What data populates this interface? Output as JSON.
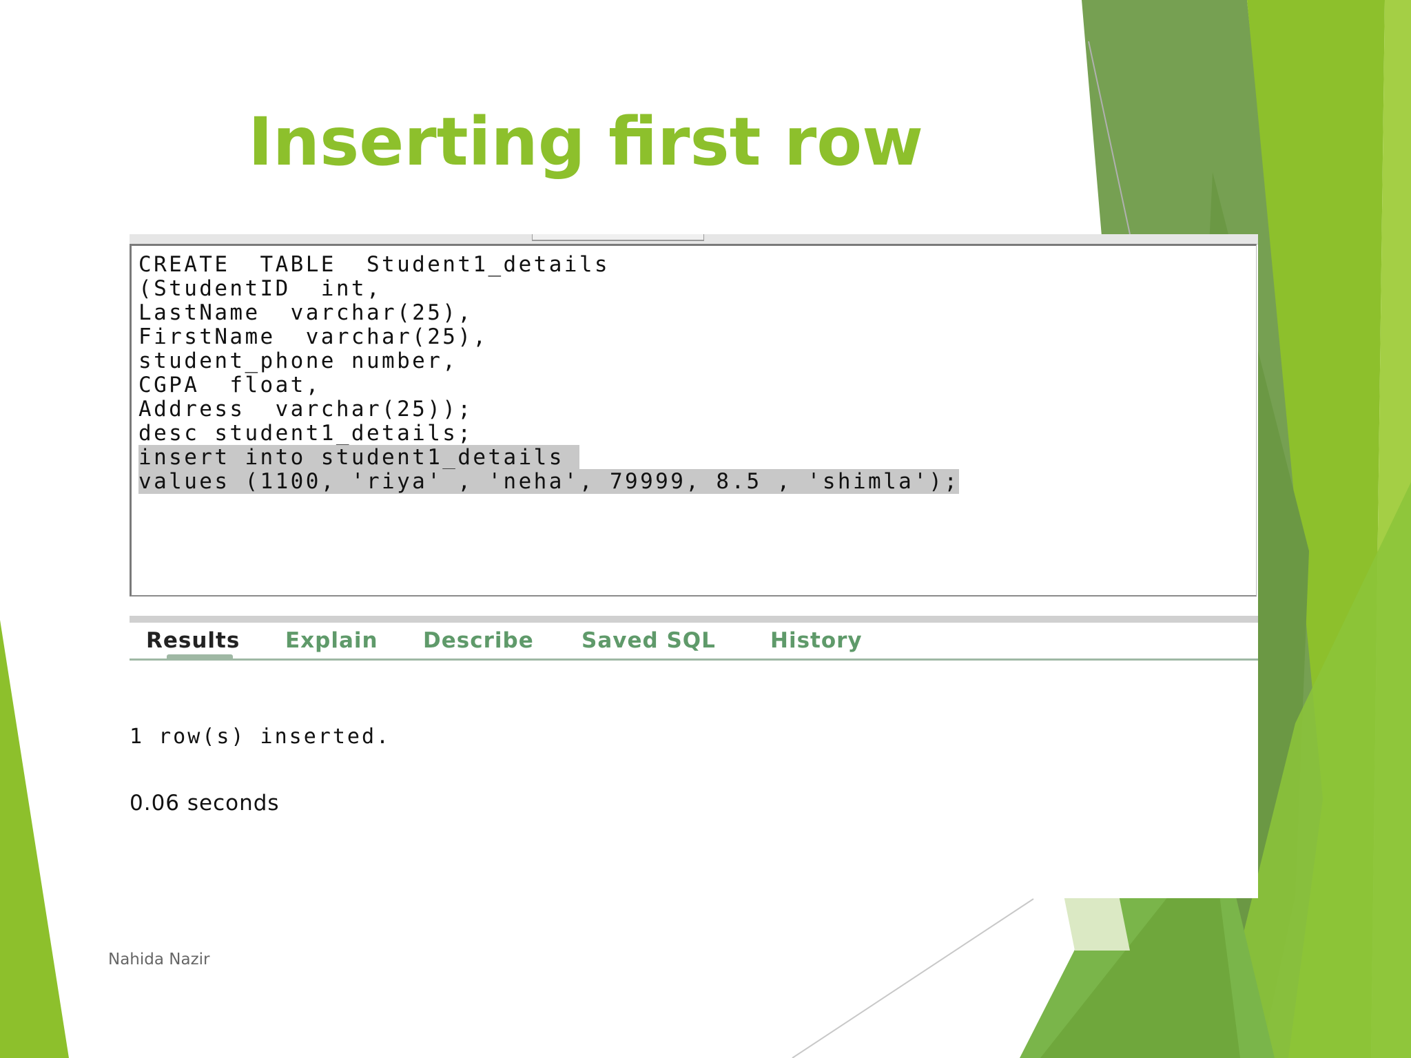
{
  "slide": {
    "title": "Inserting first row",
    "footer": "Nahida Nazir",
    "accent_color": "#8dc02c"
  },
  "editor": {
    "lines": [
      "CREATE  TABLE  Student1_details",
      "(StudentID  int,",
      "LastName  varchar(25),",
      "FirstName  varchar(25),",
      "student_phone number,",
      "CGPA  float,",
      "Address  varchar(25));",
      "desc student1_details;",
      "insert into student1_details ",
      "values (1100, 'riya' , 'neha', 79999, 8.5 , 'shimla');"
    ]
  },
  "tabs": [
    {
      "label": "Results",
      "active": true
    },
    {
      "label": "Explain",
      "active": false
    },
    {
      "label": "Describe",
      "active": false
    },
    {
      "label": "Saved SQL",
      "active": false
    },
    {
      "label": "History",
      "active": false
    }
  ],
  "results": {
    "message": "1 row(s) inserted.",
    "elapsed": "0.06 seconds"
  }
}
